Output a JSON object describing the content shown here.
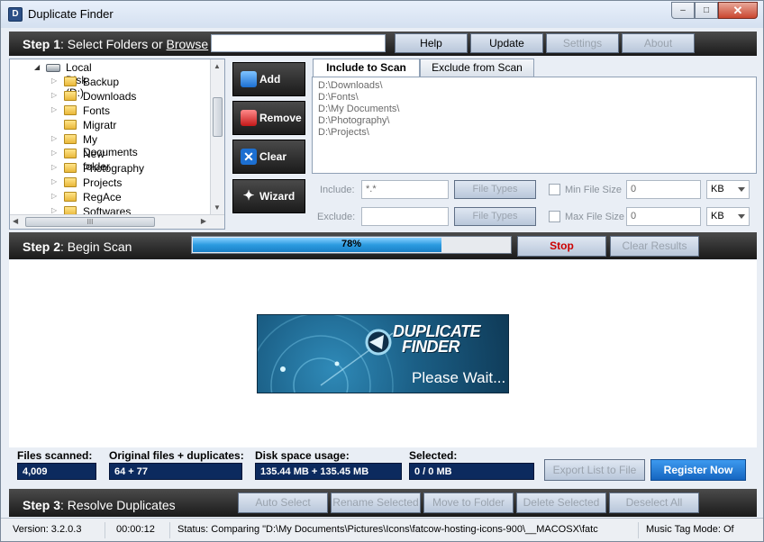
{
  "window": {
    "title": "Duplicate Finder",
    "close_label": "✕",
    "maximize_label": "□",
    "minimize_label": "–"
  },
  "step1": {
    "title_bold": "Step 1",
    "title_rest": ": Select Folders or ",
    "browse": "Browse",
    "path_value": "",
    "buttons": {
      "help": "Help",
      "update": "Update",
      "settings": "Settings",
      "about": "About"
    }
  },
  "tree": {
    "root": "Local Disk (D:)",
    "folders": [
      "Backup",
      "Downloads",
      "Fonts",
      "Migratr",
      "My Documents",
      "New folder",
      "Photography",
      "Projects",
      "RegAce",
      "Softwares"
    ],
    "hscroll_grip": "III"
  },
  "actions": {
    "add": "Add",
    "remove": "Remove",
    "clear": "Clear",
    "wizard": "Wizard"
  },
  "tabs": {
    "include": "Include to Scan",
    "exclude": "Exclude from Scan"
  },
  "include_list": [
    "D:\\Downloads\\",
    "D:\\Fonts\\",
    "D:\\My Documents\\",
    "D:\\Photography\\",
    "D:\\Projects\\"
  ],
  "filters": {
    "include_label": "Include:",
    "include_value": "*.*",
    "exclude_label": "Exclude:",
    "exclude_value": "",
    "file_types": "File Types",
    "min_size_label": "Min File Size",
    "min_size_value": "0",
    "max_size_label": "Max File Size",
    "max_size_value": "0",
    "unit": "KB"
  },
  "step2": {
    "title_bold": "Step 2",
    "title_rest": ": Begin Scan",
    "progress_percent": 78,
    "progress_text": "78%",
    "stop": "Stop",
    "clear_results": "Clear Results"
  },
  "banner": {
    "line1": "DUPLICATE",
    "line2": "FINDER",
    "wait": "Please Wait..."
  },
  "stats": {
    "files_scanned_label": "Files scanned:",
    "files_scanned": "4,009",
    "original_label": "Original files + duplicates:",
    "original": "64 + 77",
    "disk_label": "Disk space usage:",
    "disk": "135.44 MB + 135.45 MB",
    "selected_label": "Selected:",
    "selected": "0 / 0 MB",
    "export": "Export List to File",
    "register": "Register Now"
  },
  "step3": {
    "title_bold": "Step 3",
    "title_rest": ": Resolve Duplicates",
    "buttons": {
      "auto_select": "Auto Select",
      "rename_selected": "Rename Selected",
      "move_to_folder": "Move to Folder",
      "delete_selected": "Delete Selected",
      "deselect_all": "Deselect All"
    }
  },
  "statusbar": {
    "version": "Version: 3.2.0.3",
    "time": "00:00:12",
    "status": "Status: Comparing \"D:\\My Documents\\Pictures\\Icons\\fatcow-hosting-icons-900\\__MACOSX\\fatc",
    "music_mode": "Music Tag Mode: Of"
  },
  "colors": {
    "accent_dark": "#1a1a1a",
    "progress": "#2b9be0",
    "stat_box": "#0c2a5e",
    "register": "#1f7fd8",
    "stop_text": "#cc0000"
  }
}
